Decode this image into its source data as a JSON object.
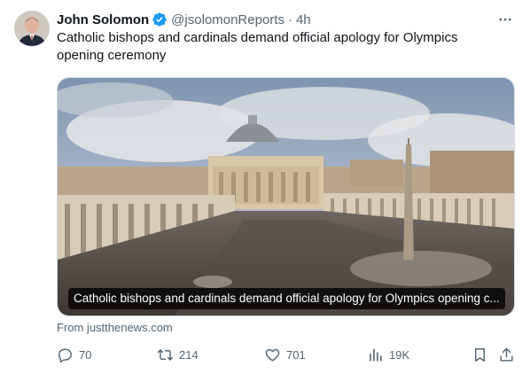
{
  "author": {
    "name": "John Solomon",
    "handle": "@jsolomonReports",
    "separator": "·",
    "time": "4h",
    "verified_color": "#1d9bf0"
  },
  "tweet": {
    "text": "Catholic bishops and cardinals demand official apology for Olympics opening ceremony"
  },
  "card": {
    "caption": "Catholic bishops and cardinals demand official apology for Olympics opening c...",
    "source": "From justthenews.com"
  },
  "actions": {
    "replies": "70",
    "reposts": "214",
    "likes": "701",
    "views": "19K"
  },
  "icons": {
    "more": "more-icon",
    "reply": "reply-icon",
    "repost": "repost-icon",
    "like": "like-icon",
    "views": "views-icon",
    "bookmark": "bookmark-icon",
    "share": "share-icon"
  }
}
